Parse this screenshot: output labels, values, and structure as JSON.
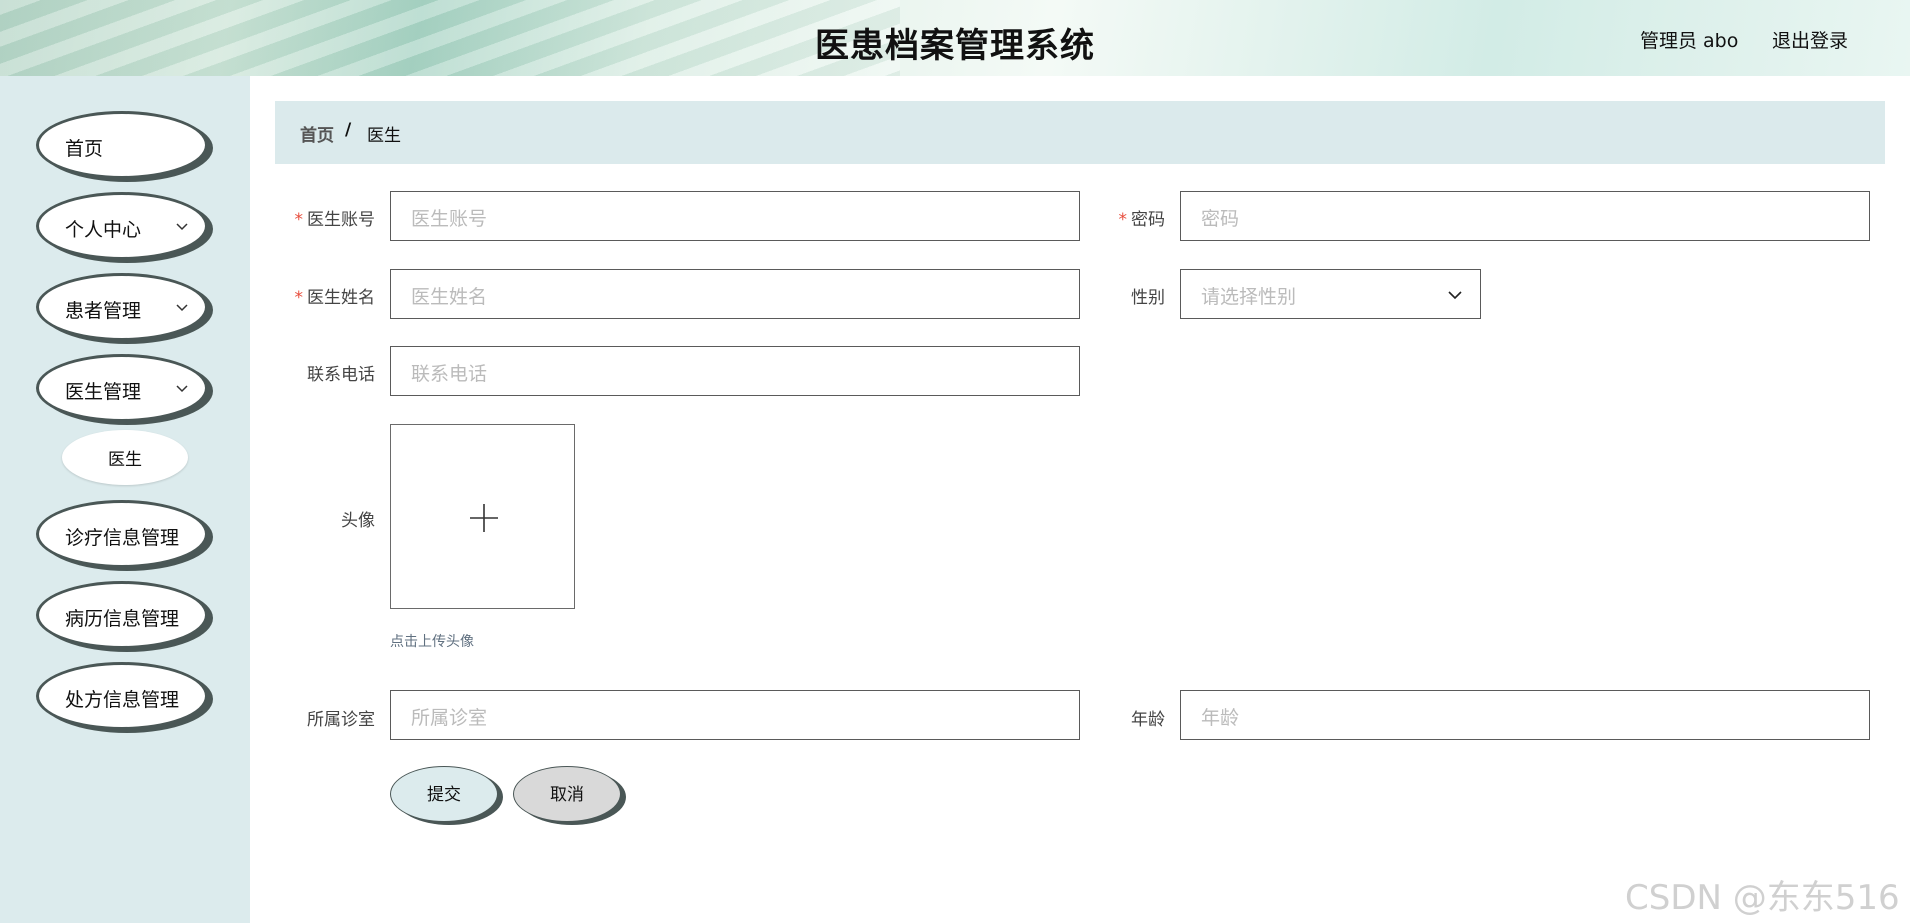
{
  "header": {
    "title": "医患档案管理系统",
    "user_label": "管理员 abo",
    "logout_label": "退出登录"
  },
  "sidebar": {
    "items": [
      {
        "label": "首页",
        "has_chevron": false
      },
      {
        "label": "个人中心",
        "has_chevron": true
      },
      {
        "label": "患者管理",
        "has_chevron": true
      },
      {
        "label": "医生管理",
        "has_chevron": true,
        "expanded": true
      },
      {
        "label": "诊疗信息管理",
        "has_chevron": false
      },
      {
        "label": "病历信息管理",
        "has_chevron": false
      },
      {
        "label": "处方信息管理",
        "has_chevron": false
      }
    ],
    "subitem": {
      "label": "医生"
    }
  },
  "breadcrumb": {
    "home": "首页",
    "separator": "/",
    "current": "医生"
  },
  "form": {
    "account": {
      "label": "医生账号",
      "required": true,
      "placeholder": "医生账号",
      "value": ""
    },
    "password": {
      "label": "密码",
      "required": true,
      "placeholder": "密码",
      "value": ""
    },
    "name": {
      "label": "医生姓名",
      "required": true,
      "placeholder": "医生姓名",
      "value": ""
    },
    "gender": {
      "label": "性别",
      "required": false,
      "placeholder": "请选择性别",
      "value": ""
    },
    "phone": {
      "label": "联系电话",
      "required": false,
      "placeholder": "联系电话",
      "value": ""
    },
    "avatar": {
      "label": "头像",
      "tip": "点击上传头像"
    },
    "clinic": {
      "label": "所属诊室",
      "required": false,
      "placeholder": "所属诊室",
      "value": ""
    },
    "age": {
      "label": "年龄",
      "required": false,
      "placeholder": "年龄",
      "value": ""
    },
    "required_mark": "*"
  },
  "buttons": {
    "submit": "提交",
    "cancel": "取消"
  },
  "watermark": "CSDN @东东516",
  "colors": {
    "sidebar_bg": "#dcebed",
    "menu_shadow": "#4a5756",
    "required": "#e74c3c",
    "breadcrumb_bg": "#dbeaec"
  }
}
